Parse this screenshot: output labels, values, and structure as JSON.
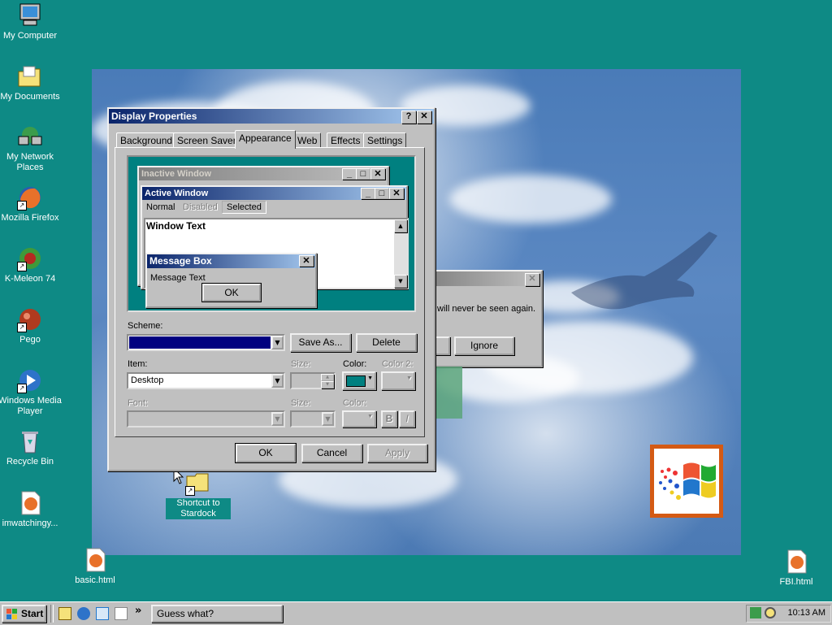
{
  "desktop": {
    "icons": [
      {
        "label": "My Computer",
        "icon": "computer-icon"
      },
      {
        "label": "My Documents",
        "icon": "folder-icon"
      },
      {
        "label": "My Network Places",
        "icon": "network-icon"
      },
      {
        "label": "Mozilla Firefox",
        "icon": "firefox-icon"
      },
      {
        "label": "K-Meleon 74",
        "icon": "kmeleon-icon"
      },
      {
        "label": "Pego",
        "icon": "pego-icon"
      },
      {
        "label": "Windows Media Player",
        "icon": "media-player-icon"
      },
      {
        "label": "Recycle Bin",
        "icon": "recycle-bin-icon"
      },
      {
        "label": "imwatchingy...",
        "icon": "html-file-icon"
      },
      {
        "label": "basic.html",
        "icon": "html-file-icon"
      },
      {
        "label": "FBI.html",
        "icon": "html-file-icon"
      },
      {
        "label": "Shortcut to Stardock",
        "icon": "folder-icon"
      }
    ]
  },
  "bg_dialog": {
    "message": "will never be seen again.",
    "ignore_label": "Ignore",
    "close_glyph": "✕"
  },
  "display_properties": {
    "title": "Display Properties",
    "help_glyph": "?",
    "close_glyph": "✕",
    "tabs": [
      "Background",
      "Screen Saver",
      "Appearance",
      "Web",
      "Effects",
      "Settings"
    ],
    "active_tab": "Appearance",
    "preview": {
      "inactive_title": "Inactive Window",
      "active_title": "Active Window",
      "menu": [
        "Normal",
        "Disabled",
        "Selected"
      ],
      "window_text": "Window Text",
      "msgbox_title": "Message Box",
      "msgbox_text": "Message Text",
      "msgbox_ok": "OK"
    },
    "scheme_label": "Scheme:",
    "scheme_value": "",
    "save_as_label": "Save As...",
    "delete_label": "Delete",
    "item_label": "Item:",
    "item_value": "Desktop",
    "size_label": "Size:",
    "color_label": "Color:",
    "color2_label": "Color 2:",
    "font_label": "Font:",
    "font_size_label": "Size:",
    "font_color_label": "Color:",
    "bold_label": "B",
    "italic_label": "I",
    "ok_label": "OK",
    "cancel_label": "Cancel",
    "apply_label": "Apply",
    "desktop_color": "#008080"
  },
  "taskbar": {
    "start_label": "Start",
    "task_label": "Guess what?",
    "clock": "10:13 AM",
    "chevron": "»"
  }
}
